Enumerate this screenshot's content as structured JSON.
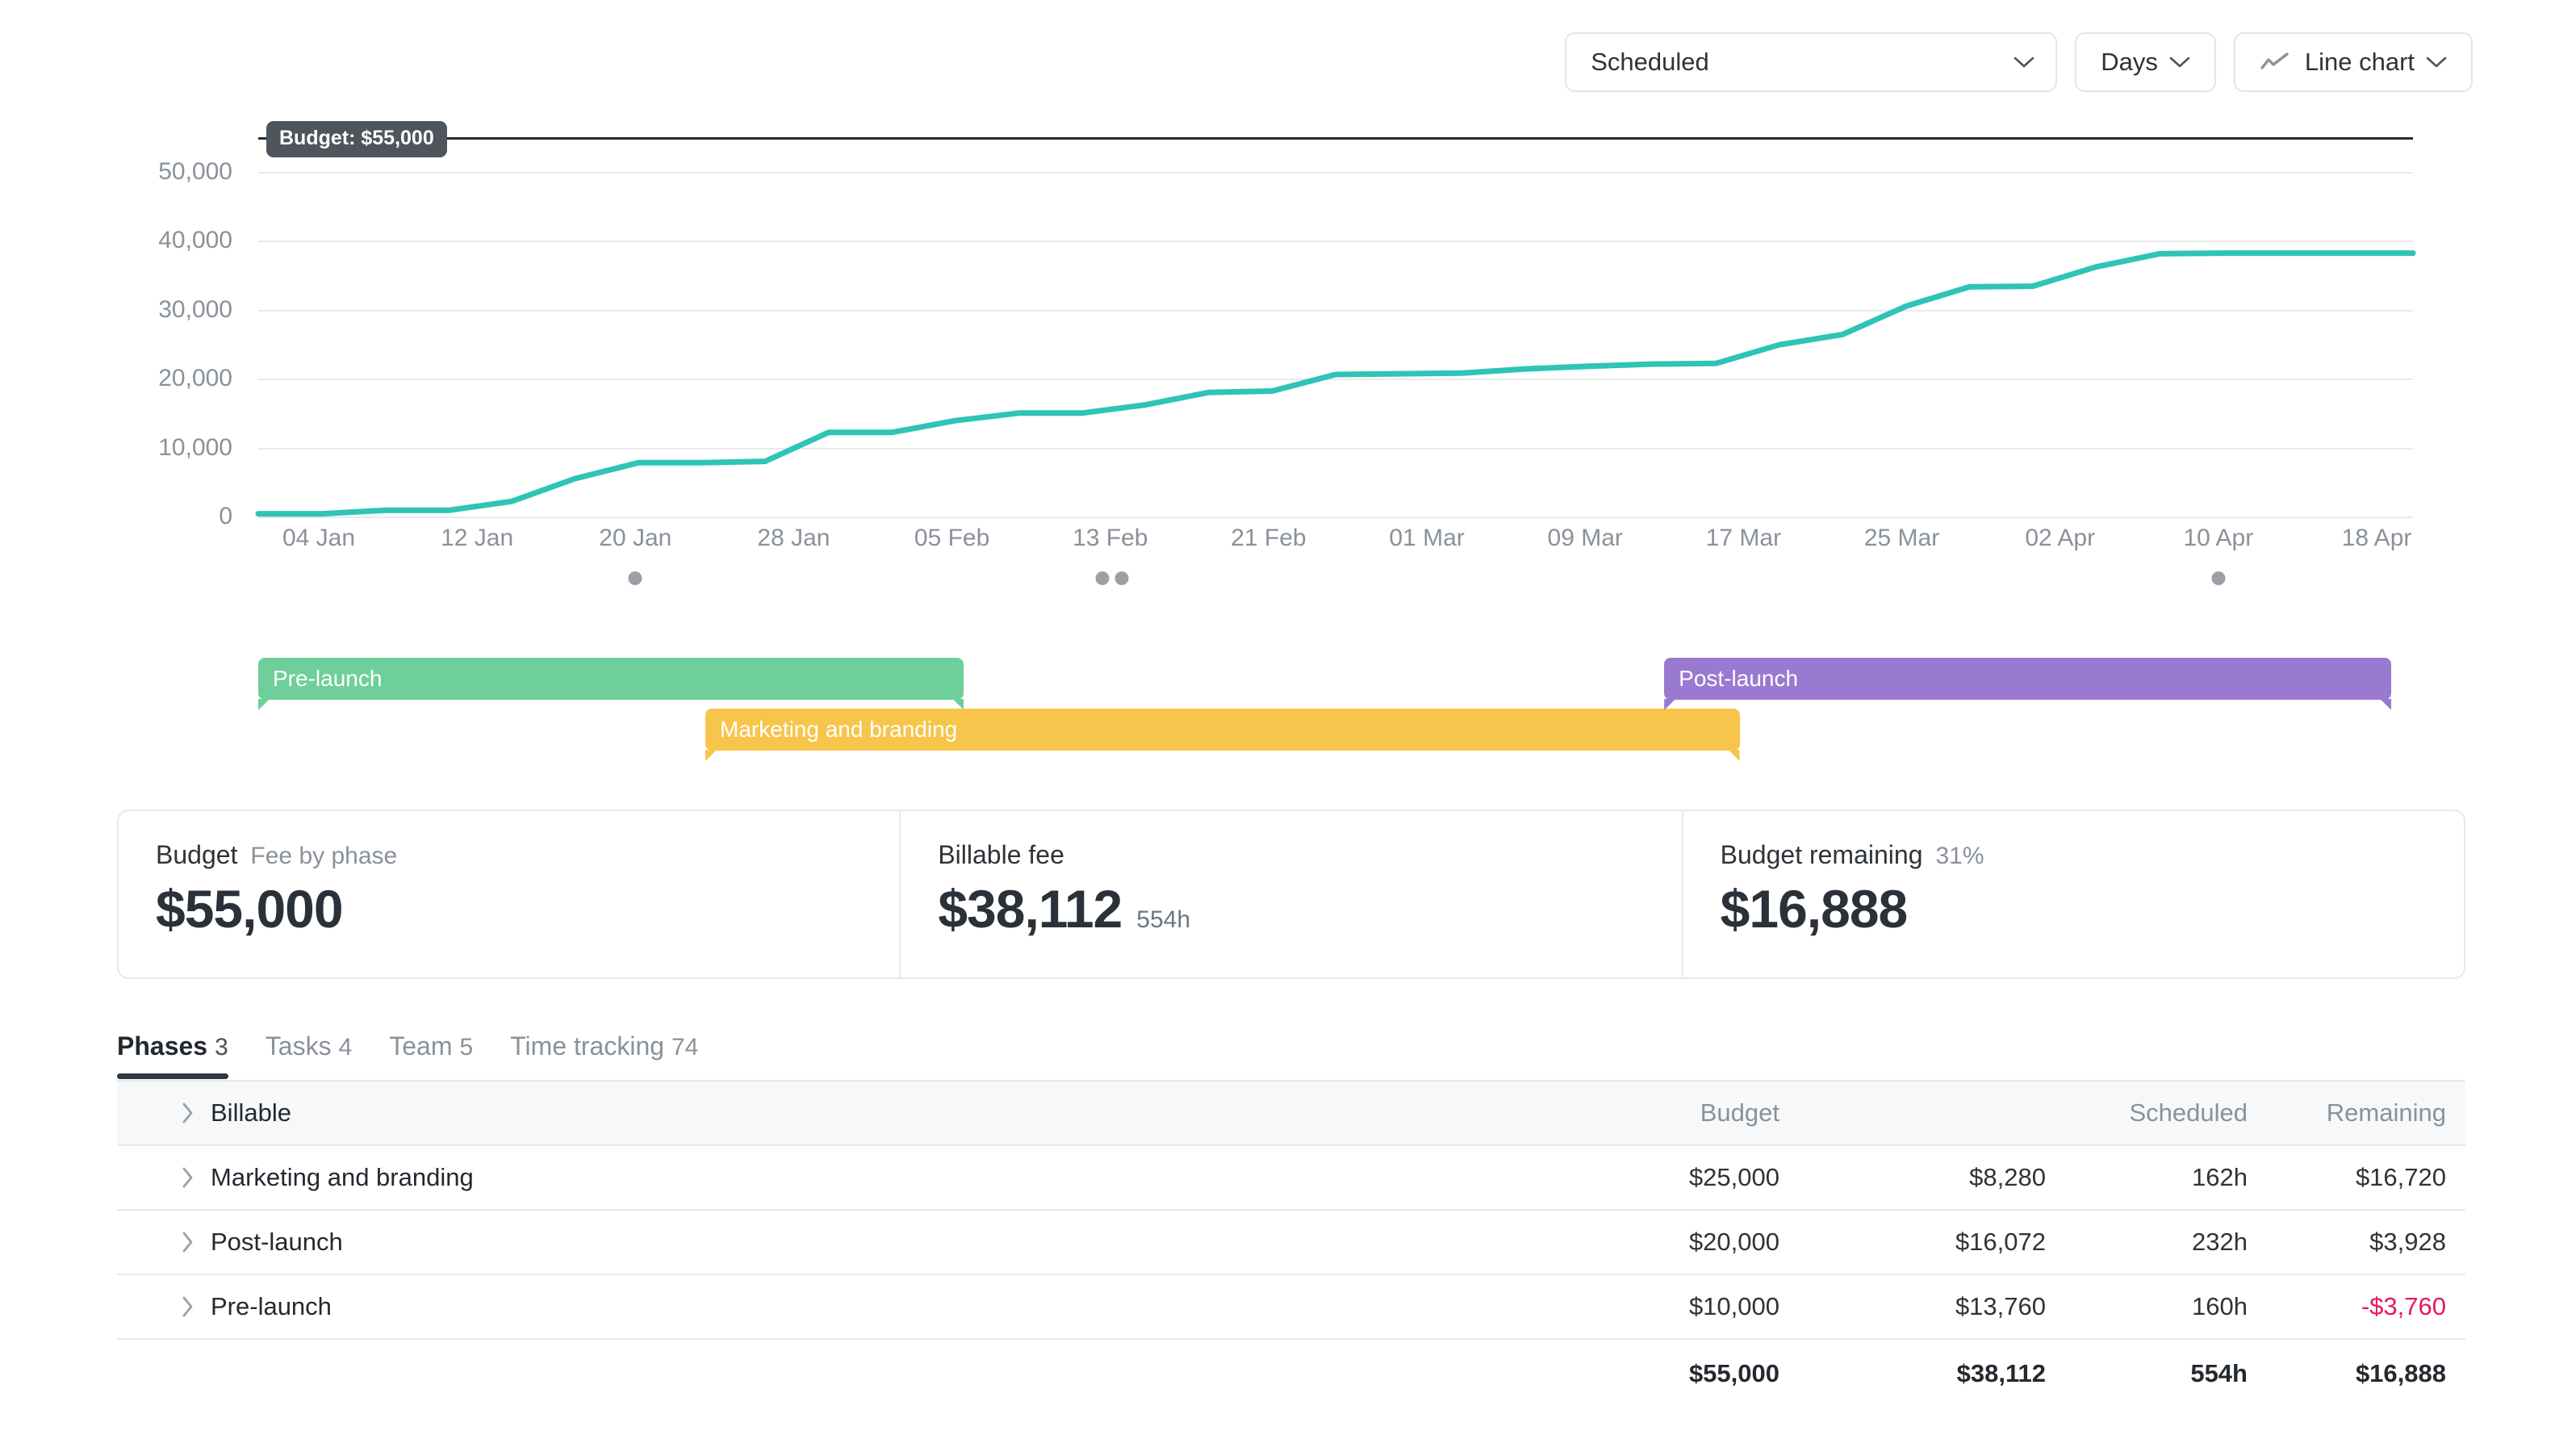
{
  "toolbar": {
    "view_select": {
      "value": "Scheduled",
      "icon": "chevron-down-icon"
    },
    "granularity_select": {
      "value": "Days",
      "icon": "chevron-down-icon"
    },
    "chart_type_select": {
      "value": "Line chart",
      "icon": "line-chart-icon"
    }
  },
  "chart_data": {
    "type": "line",
    "title": "",
    "xlabel": "",
    "ylabel": "",
    "ylim": [
      0,
      55000
    ],
    "grid": true,
    "legend_position": "none",
    "budget_line": {
      "value": 55000,
      "label": "Budget: $55,000"
    },
    "ytick_labels": [
      "50,000",
      "40,000",
      "30,000",
      "20,000",
      "10,000",
      "0"
    ],
    "ytick_values": [
      50000,
      40000,
      30000,
      20000,
      10000,
      0
    ],
    "xtick_labels": [
      "04 Jan",
      "12 Jan",
      "20 Jan",
      "28 Jan",
      "05 Feb",
      "13 Feb",
      "21 Feb",
      "01 Mar",
      "09 Mar",
      "17 Mar",
      "25 Mar",
      "02 Apr",
      "10 Apr",
      "18 Apr"
    ],
    "milestone_dots": [
      "20 Jan",
      "13 Feb",
      "13 Feb",
      "10 Apr"
    ],
    "series": [
      {
        "name": "Scheduled",
        "color": "#2ec4b6",
        "x": [
          "02 Jan",
          "04 Jan",
          "08 Jan",
          "11 Jan",
          "13 Jan",
          "15 Jan",
          "18 Jan",
          "20 Jan",
          "22 Jan",
          "25 Jan",
          "27 Jan",
          "30 Jan",
          "01 Feb",
          "05 Feb",
          "08 Feb",
          "11 Feb",
          "14 Feb",
          "18 Feb",
          "22 Feb",
          "26 Feb",
          "01 Mar",
          "04 Mar",
          "07 Mar",
          "09 Mar",
          "12 Mar",
          "15 Mar",
          "17 Mar",
          "20 Mar",
          "23 Mar",
          "25 Mar",
          "29 Mar",
          "02 Apr",
          "10 Apr",
          "18 Apr",
          "22 Apr"
        ],
        "values": [
          400,
          400,
          900,
          900,
          2200,
          5500,
          7800,
          7800,
          8000,
          12200,
          12200,
          13900,
          15000,
          15000,
          16200,
          18000,
          18200,
          20600,
          20700,
          20800,
          21400,
          21800,
          22100,
          22200,
          24900,
          26400,
          30500,
          33300,
          33400,
          36200,
          38100,
          38200,
          38200,
          38200,
          38200
        ]
      }
    ],
    "phases": [
      {
        "label": "Pre-launch",
        "color": "#6ecf9b",
        "start_pct": 0.0,
        "end_pct": 13.1
      },
      {
        "label": "Marketing and branding",
        "color": "#f7c54b",
        "start_pct": 8.3,
        "end_pct": 27.5
      },
      {
        "label": "Post-launch",
        "color": "#9a79d0",
        "start_pct": 26.1,
        "end_pct": 39.6
      }
    ]
  },
  "cards": [
    {
      "title": "Budget",
      "sub": "Fee by phase",
      "value": "$55,000",
      "value_sub": ""
    },
    {
      "title": "Billable fee",
      "sub": "",
      "value": "$38,112",
      "value_sub": "554h"
    },
    {
      "title": "Budget remaining",
      "sub": "31%",
      "value": "$16,888",
      "value_sub": ""
    }
  ],
  "tabs": [
    {
      "label": "Phases",
      "count": "3",
      "active": true
    },
    {
      "label": "Tasks",
      "count": "4",
      "active": false
    },
    {
      "label": "Team",
      "count": "5",
      "active": false
    },
    {
      "label": "Time tracking",
      "count": "74",
      "active": false
    }
  ],
  "table": {
    "header": {
      "name": "Billable",
      "budget": "Budget",
      "spent": "",
      "scheduled": "Scheduled",
      "remaining": "Remaining"
    },
    "rows": [
      {
        "name": "Marketing and branding",
        "budget": "$25,000",
        "spent": "$8,280",
        "scheduled": "162h",
        "remaining": "$16,720",
        "remaining_negative": false
      },
      {
        "name": "Post-launch",
        "budget": "$20,000",
        "spent": "$16,072",
        "scheduled": "232h",
        "remaining": "$3,928",
        "remaining_negative": false
      },
      {
        "name": "Pre-launch",
        "budget": "$10,000",
        "spent": "$13,760",
        "scheduled": "160h",
        "remaining": "-$3,760",
        "remaining_negative": true
      }
    ],
    "total": {
      "name": "",
      "budget": "$55,000",
      "spent": "$38,112",
      "scheduled": "554h",
      "remaining": "$16,888"
    }
  },
  "colors": {
    "accent_teal": "#2ec4b6",
    "negative": "#e8175d",
    "phase_green": "#6ecf9b",
    "phase_yellow": "#f7c54b",
    "phase_purple": "#9a79d0",
    "budget_line": "#222b33"
  }
}
